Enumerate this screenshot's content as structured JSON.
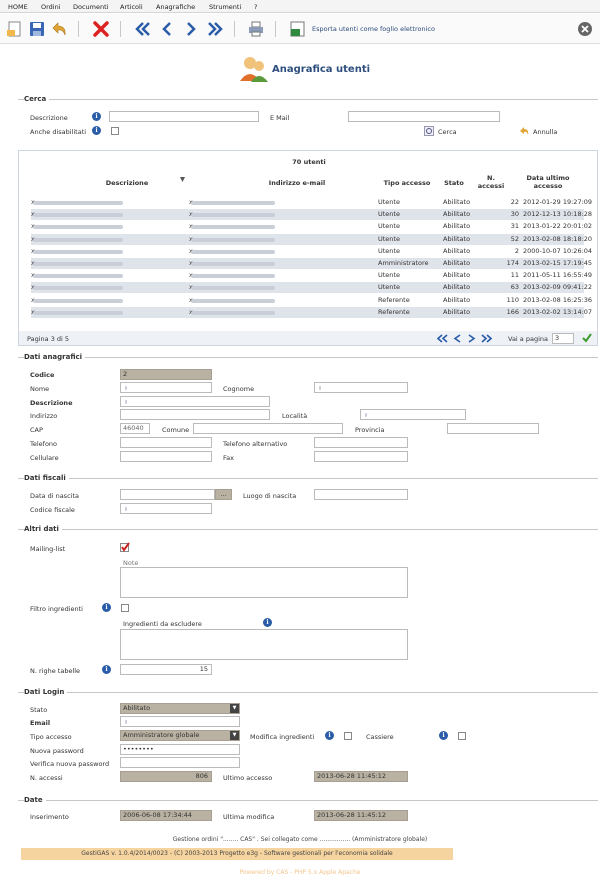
{
  "menu": [
    "HOME",
    "Ordini",
    "Documenti",
    "Articoli",
    "Anagrafiche",
    "Strumenti",
    "?"
  ],
  "toolbar": {
    "export_label": "Esporta utenti come foglio elettronico"
  },
  "page_title": "Anagrafica utenti",
  "search": {
    "legend": "Cerca",
    "desc_label": "Descrizione",
    "email_label": "E Mail",
    "disabled_label": "Anche disabilitati",
    "search_btn": "Cerca",
    "cancel_btn": "Annulla"
  },
  "grid": {
    "count": "70 utenti",
    "columns": [
      "Descrizione",
      "Indirizzo e-mail",
      "Tipo accesso",
      "Stato",
      "N. accessi",
      "Data ultimo accesso"
    ],
    "rows": [
      [
        "Utente",
        "Abilitato",
        "22",
        "2012-01-29 19:27:09"
      ],
      [
        "Utente",
        "Abilitato",
        "30",
        "2012-12-13 10:18:28"
      ],
      [
        "Utente",
        "Abilitato",
        "31",
        "2013-01-22 20:01:02"
      ],
      [
        "Utente",
        "Abilitato",
        "52",
        "2013-02-08 18:18:20"
      ],
      [
        "Utente",
        "Abilitato",
        "2",
        "2000-10-07 10:26:04"
      ],
      [
        "Amministratore",
        "Abilitato",
        "174",
        "2013-02-15 17:19:45"
      ],
      [
        "Utente",
        "Abilitato",
        "11",
        "2011-05-11 16:55:49"
      ],
      [
        "Utente",
        "Abilitato",
        "63",
        "2013-02-09 09:41:22"
      ],
      [
        "Referente",
        "Abilitato",
        "110",
        "2013-02-08 16:25:36"
      ],
      [
        "Referente",
        "Abilitato",
        "166",
        "2013-02-02 13:14:07"
      ]
    ],
    "page_info": "Pagina 3 di 5",
    "goto_label": "Vai a pagina",
    "goto_value": "3"
  },
  "anag": {
    "legend": "Dati anagrafici",
    "codice": "Codice",
    "codice_val": "2",
    "nome": "Nome",
    "cognome": "Cognome",
    "descrizione": "Descrizione",
    "indirizzo": "Indirizzo",
    "localita": "Località",
    "cap": "CAP",
    "cap_val": "46040",
    "comune": "Comune",
    "provincia": "Provincia",
    "telefono": "Telefono",
    "tel_alt": "Telefono alternativo",
    "cellulare": "Cellulare",
    "fax": "Fax"
  },
  "fiscali": {
    "legend": "Dati fiscali",
    "nascita": "Data di nascita",
    "luogo": "Luogo di nascita",
    "cf": "Codice fiscale",
    "dots": "..."
  },
  "altri": {
    "legend": "Altri dati",
    "mailing": "Mailing-list",
    "note": "Note",
    "filtro": "Filtro ingredienti",
    "escludere": "Ingredienti da escludere",
    "righe": "N. righe tabelle",
    "righe_val": "15"
  },
  "login": {
    "legend": "Dati Login",
    "stato": "Stato",
    "stato_val": "Abilitato",
    "email": "Email",
    "tipo": "Tipo accesso",
    "tipo_val": "Amministratore globale",
    "modifica_ing": "Modifica ingredienti",
    "cassiere": "Cassiere",
    "nuova_pw": "Nuova password",
    "pw_val": "••••••••",
    "verifica_pw": "Verifica nuova password",
    "accessi": "N. accessi",
    "accessi_val": "806",
    "ultimo": "Ultimo accesso",
    "ultimo_val": "2013-06-28 11:45:12"
  },
  "date": {
    "legend": "Date",
    "inserimento": "Inserimento",
    "ins_val": "2006-06-08 17:34:44",
    "ultima_mod": "Ultima modifica",
    "mod_val": "2013-06-28 11:45:12"
  },
  "footer": {
    "line1": "Gestione ordini \"........ CAS\" . Sei collegato come ................ (Amministratore globale)",
    "line2": "GestiGAS v. 1.0.4/2014/0023 - (C) 2003-2013 Progetto e3g - Software gestionali per l'economia solidale",
    "line3": "Powered by CAS - PHP 5.x Apple Apache"
  }
}
